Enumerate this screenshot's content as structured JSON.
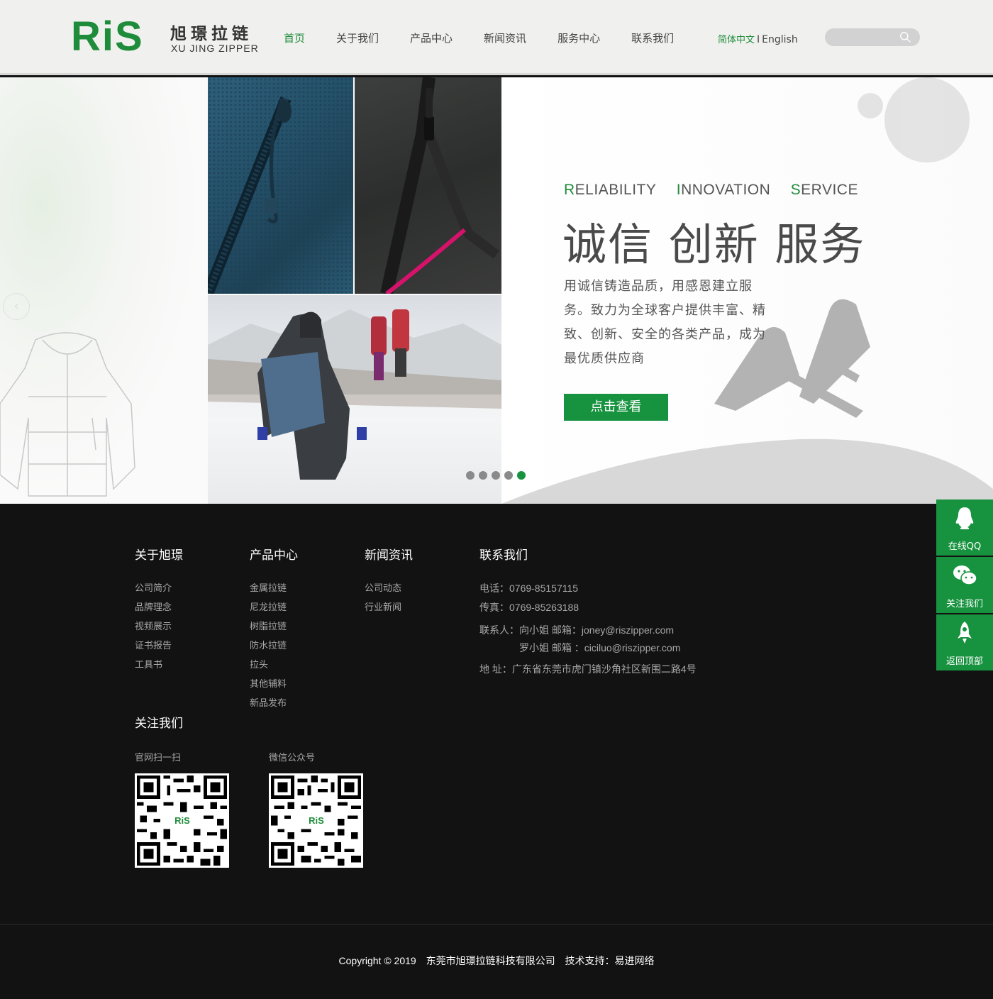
{
  "brand": {
    "logo_mark": "RiS",
    "name_cn": "旭璟拉链",
    "name_en": "XU JING ZIPPER",
    "green": "#1e8c3a"
  },
  "nav": {
    "items": [
      {
        "label": "首页",
        "active": true
      },
      {
        "label": "关于我们"
      },
      {
        "label": "产品中心"
      },
      {
        "label": "新闻资讯"
      },
      {
        "label": "服务中心"
      },
      {
        "label": "联系我们"
      }
    ],
    "lang_cn": "简体中文",
    "lang_sep": "I",
    "lang_en": "English",
    "search_icon": "search-icon"
  },
  "banner": {
    "tagline_en": [
      {
        "initial": "R",
        "rest": "ELIABILITY"
      },
      {
        "initial": "I",
        "rest": "NNOVATION"
      },
      {
        "initial": "S",
        "rest": "ERVICE"
      }
    ],
    "tagline_cn": "诚信 创新 服务",
    "description": "用诚信铸造品质，用感恩建立服务。致力为全球客户提供丰富、精致、创新、安全的各类产品，成为最优质供应商",
    "cta": "点击查看",
    "slides": 5,
    "active_slide": 5
  },
  "side_float": [
    {
      "label": "在线QQ",
      "icon": "qq-icon"
    },
    {
      "label": "关注我们",
      "icon": "wechat-icon"
    },
    {
      "label": "返回顶部",
      "icon": "rocket-icon"
    }
  ],
  "footer": {
    "about": {
      "title": "关于旭璟",
      "links": [
        "公司简介",
        "品牌理念",
        "视频展示",
        "证书报告",
        "工具书"
      ]
    },
    "products": {
      "title": "产品中心",
      "links": [
        "金属拉链",
        "尼龙拉链",
        "树脂拉链",
        "防水拉链",
        "拉头",
        "其他辅料",
        "新品发布"
      ]
    },
    "news": {
      "title": "新闻资讯",
      "links": [
        "公司动态",
        "行业新闻"
      ]
    },
    "contact": {
      "title": "联系我们",
      "phone": "电话：0769-85157115",
      "fax": "传真：0769-85263188",
      "contact1": "联系人：向小姐  邮箱：joney@riszipper.com",
      "contact2": "罗小姐  邮箱 ：ciciluo@riszipper.com",
      "address": "地  址：广东省东莞市虎门镇沙角社区新围二路4号"
    },
    "follow": {
      "title": "关注我们",
      "qr1_label": "官网扫一扫",
      "qr2_label": "微信公众号",
      "qr_logo": "RiS"
    }
  },
  "copyright": {
    "text": "Copyright © 2019",
    "company": "东莞市旭璟拉链科技有限公司",
    "support": "技术支持：易进网络"
  }
}
